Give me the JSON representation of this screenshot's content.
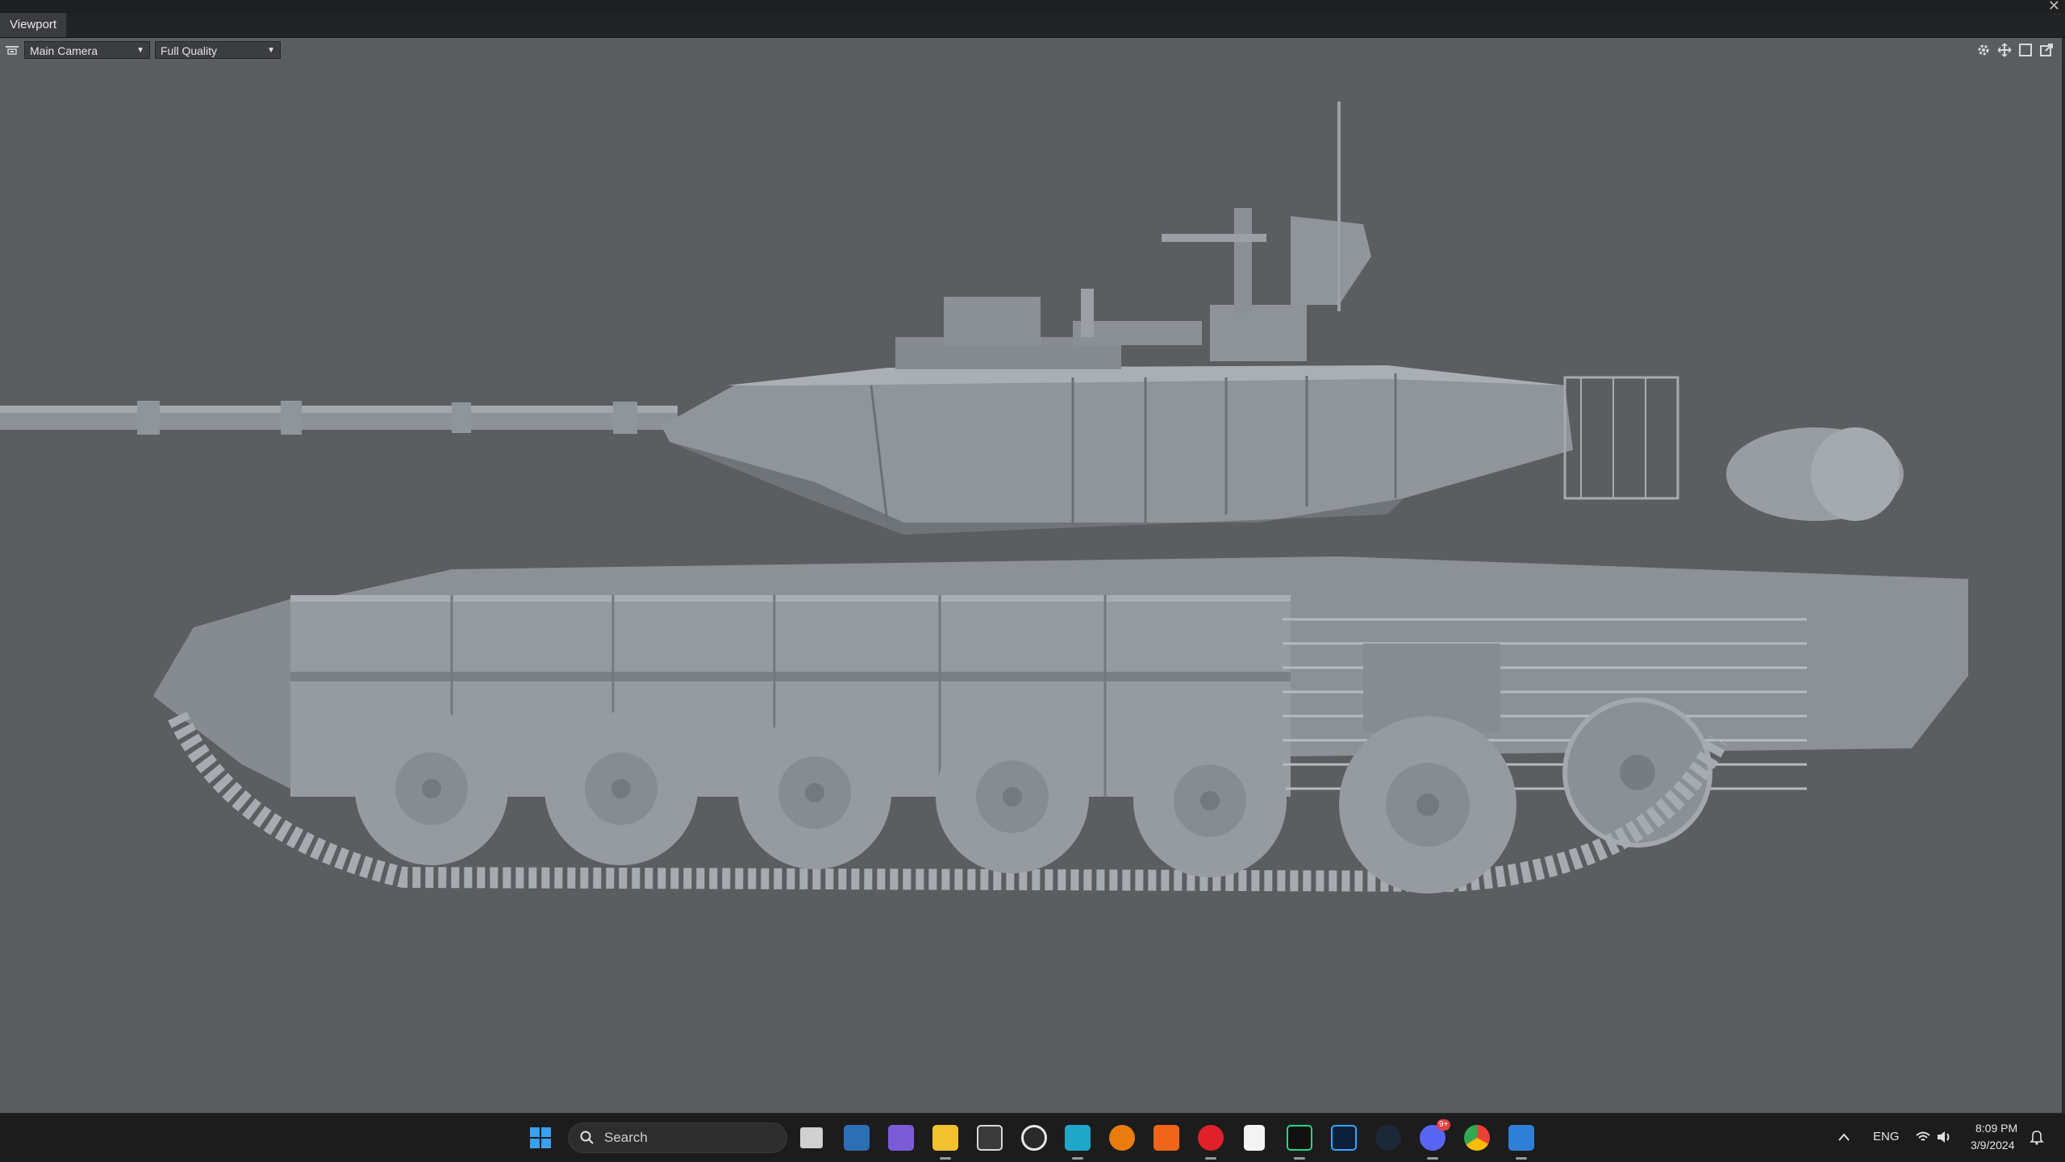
{
  "window": {
    "close_glyph": "✕"
  },
  "tabs": [
    {
      "label": "Viewport",
      "active": true
    }
  ],
  "viewport_toolbar": {
    "camera_icon": "camera-icon",
    "camera_select": {
      "value": "Main Camera",
      "arrow": "▼"
    },
    "quality_select": {
      "value": "Full Quality",
      "arrow": "▼"
    },
    "right_icons": [
      "settings-icon",
      "move-icon",
      "maximize-icon",
      "popout-icon"
    ]
  },
  "scene": {
    "subject": "3D tank model (grey clay render)",
    "background_color": "#5b5e61",
    "model_color": "#8d9399"
  },
  "taskbar": {
    "start_icon": "windows-start-icon",
    "search": {
      "placeholder": "Search"
    },
    "apps": [
      "task-view-icon",
      "remote-desktop-icon",
      "app-purple-icon",
      "file-explorer-icon",
      "unity-icon",
      "app-headset-icon",
      "marmoset-icon",
      "blender-icon",
      "app-orange-icon",
      "app-red-icon",
      "notepad-icon",
      "pycharm-icon",
      "photoshop-icon",
      "steam-icon",
      "discord-icon",
      "chrome-icon",
      "app-blue-icon"
    ],
    "discord_badge": "9+",
    "tray": {
      "language": "ENG",
      "time": "8:09 PM",
      "date": "3/9/2024"
    }
  }
}
